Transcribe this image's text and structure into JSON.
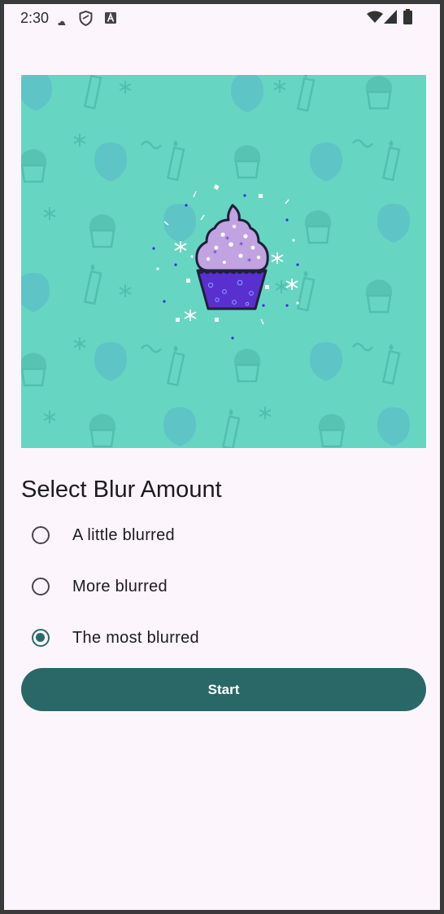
{
  "status_bar": {
    "time": "2:30",
    "icons": [
      "cloud-icon",
      "shield-icon",
      "font-a-icon",
      "wifi-icon",
      "signal-icon",
      "battery-icon"
    ]
  },
  "hero_image": {
    "subject": "cupcake-icon",
    "background_color": "#66d6c3",
    "cupcake_frosting_color": "#c0a3e0",
    "cupcake_wrapper_color": "#5a2fd0"
  },
  "blur_selector": {
    "title": "Select Blur Amount",
    "options": [
      {
        "label": "A little blurred",
        "selected": false
      },
      {
        "label": "More blurred",
        "selected": false
      },
      {
        "label": "The most blurred",
        "selected": true
      }
    ]
  },
  "actions": {
    "start_label": "Start"
  },
  "colors": {
    "accent": "#2a6868",
    "surface": "#fcf6fc",
    "on_surface": "#1d1b20"
  }
}
